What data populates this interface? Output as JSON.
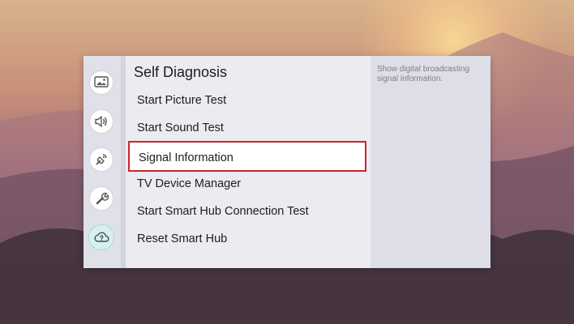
{
  "rail": {
    "icons": [
      {
        "name": "picture-icon"
      },
      {
        "name": "sound-icon"
      },
      {
        "name": "broadcasting-icon"
      },
      {
        "name": "general-wrench-icon"
      },
      {
        "name": "support-cloud-icon",
        "active": true
      }
    ]
  },
  "menu": {
    "title": "Self Diagnosis",
    "items": [
      {
        "label": "Start Picture Test"
      },
      {
        "label": "Start Sound Test"
      },
      {
        "label": "Signal Information",
        "selected": true
      },
      {
        "label": "TV Device Manager"
      },
      {
        "label": "Start Smart Hub Connection Test"
      },
      {
        "label": "Reset Smart Hub"
      }
    ]
  },
  "description": {
    "text": "Show digital broadcasting signal information."
  },
  "colors": {
    "highlight_border": "#d1232b",
    "active_rail_bg": "#d7f0f0",
    "icon_stroke": "#555555"
  }
}
